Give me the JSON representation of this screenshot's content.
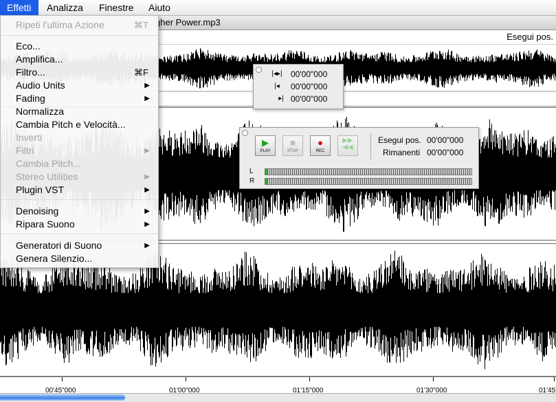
{
  "menubar": {
    "items": [
      {
        "label": "Effetti",
        "active": true
      },
      {
        "label": "Analizza",
        "active": false
      },
      {
        "label": "Finestre",
        "active": false
      },
      {
        "label": "Aiuto",
        "active": false
      }
    ]
  },
  "window": {
    "title_fragment": "gher Power.mp3"
  },
  "overview": {
    "position_label": "Esegui pos."
  },
  "menu": {
    "items": [
      {
        "label": "Ripeti l'ultima Azione",
        "shortcut": "⌘T",
        "disabled": true,
        "submenu": false
      },
      {
        "label": "Eco...",
        "shortcut": "",
        "disabled": false,
        "submenu": false
      },
      {
        "label": "Amplifica...",
        "shortcut": "",
        "disabled": false,
        "submenu": false
      },
      {
        "label": "Filtro...",
        "shortcut": "⌘F",
        "disabled": false,
        "submenu": false
      },
      {
        "label": "Audio Units",
        "shortcut": "",
        "disabled": false,
        "submenu": true
      },
      {
        "label": "Fading",
        "shortcut": "",
        "disabled": false,
        "submenu": true
      },
      {
        "label": "Normalizza",
        "shortcut": "",
        "disabled": false,
        "submenu": false
      },
      {
        "label": "Cambia Pitch e Velocità...",
        "shortcut": "",
        "disabled": false,
        "submenu": false
      },
      {
        "label": "Inverti",
        "shortcut": "",
        "disabled": true,
        "submenu": false
      },
      {
        "label": "Filtri",
        "shortcut": "",
        "disabled": true,
        "submenu": true
      },
      {
        "label": "Cambia Pitch...",
        "shortcut": "",
        "disabled": true,
        "submenu": false
      },
      {
        "label": "Stereo Utilities",
        "shortcut": "",
        "disabled": true,
        "submenu": true
      },
      {
        "label": "Plugin VST",
        "shortcut": "",
        "disabled": false,
        "submenu": true
      },
      {
        "label": "Denoising",
        "shortcut": "",
        "disabled": false,
        "submenu": true
      },
      {
        "label": "Ripara Suono",
        "shortcut": "",
        "disabled": false,
        "submenu": true
      },
      {
        "label": "Generatori di Suono",
        "shortcut": "",
        "disabled": false,
        "submenu": true
      },
      {
        "label": "Genera Silenzio...",
        "shortcut": "",
        "disabled": false,
        "submenu": false
      }
    ]
  },
  "selection_palette": {
    "rows": [
      {
        "icon": "selection-length-icon",
        "value": "00'00\"000"
      },
      {
        "icon": "selection-start-icon",
        "value": "00'00\"000"
      },
      {
        "icon": "selection-end-icon",
        "value": "00'00\"000"
      }
    ]
  },
  "transport": {
    "buttons": [
      {
        "label": "PLAY",
        "icon": "play-icon",
        "color": "#1aa21a"
      },
      {
        "label": "STOP",
        "icon": "stop-icon",
        "color": "#9a9a9a"
      },
      {
        "label": "REC",
        "icon": "record-icon",
        "color": "#d01010"
      },
      {
        "label": "",
        "icon": "fast-forward-rewind-icon",
        "color": "#55c055"
      }
    ],
    "play_pos_label": "Esegui pos.",
    "play_pos_value": "00'00\"000",
    "remaining_label": "Rimanenti",
    "remaining_value": "00'00\"000",
    "meters": [
      {
        "channel": "L",
        "level": 0.01
      },
      {
        "channel": "R",
        "level": 0.01
      }
    ]
  },
  "timeline": {
    "ticks": [
      "00'45\"000",
      "01'00\"000",
      "01'15\"000",
      "01'30\"000",
      "01'45\""
    ]
  },
  "colors": {
    "accent": "#1c5ee8",
    "waveform": "#000000"
  }
}
